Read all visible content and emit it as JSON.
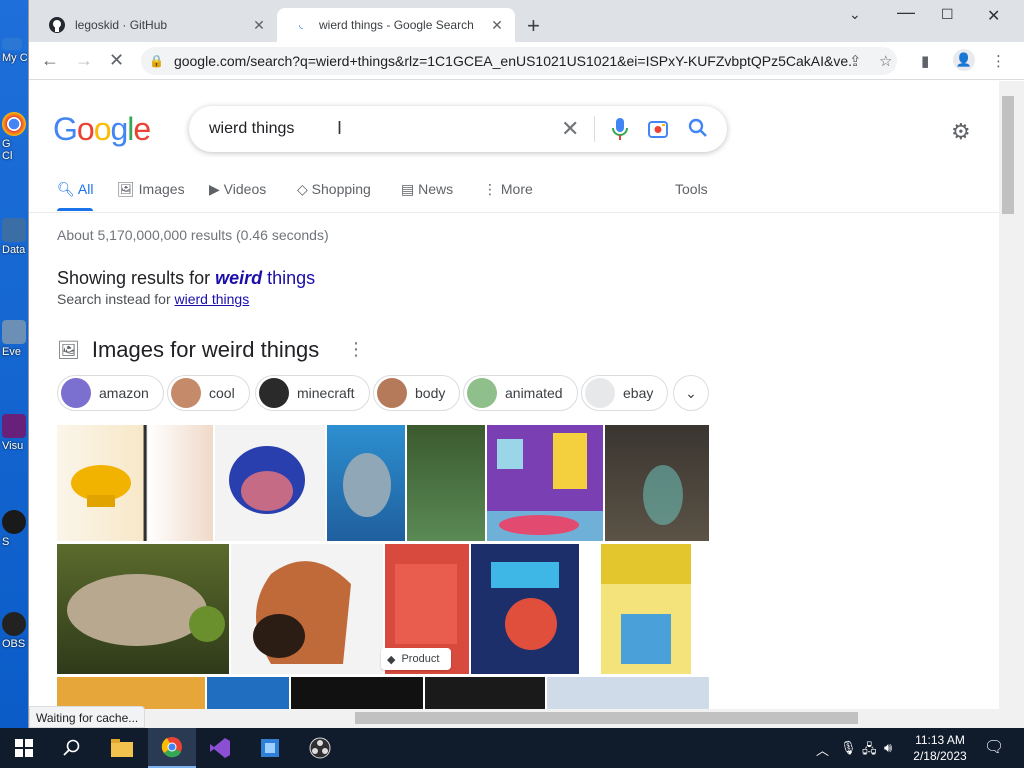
{
  "browser": {
    "tabs": [
      {
        "title": "legoskid · GitHub",
        "active": false
      },
      {
        "title": "wierd things - Google Search",
        "active": true
      }
    ],
    "url": "google.com/search?q=wierd+things&rlz=1C1GCEA_enUS1021US1021&ei=ISPxY-KUFZvbptQPz5CakAI&ve...",
    "status": "Waiting for cache..."
  },
  "google": {
    "logo": "Google",
    "query": "wierd things",
    "tabs": [
      "All",
      "Images",
      "Videos",
      "Shopping",
      "News",
      "More"
    ],
    "tools": "Tools",
    "stats": "About 5,170,000,000 results (0.46 seconds)",
    "showing_prefix": "Showing results for ",
    "showing_bold": "weird",
    "showing_rest": " things",
    "instead_prefix": "Search instead for ",
    "instead_link": "wierd things",
    "images_heading": "Images for weird things",
    "chips": [
      "amazon",
      "cool",
      "minecraft",
      "body",
      "animated",
      "ebay"
    ],
    "product_badge": "Product"
  },
  "desktop_labels": [
    "My C",
    "G",
    "Cl",
    "Data",
    "Eve",
    "Visu",
    "S",
    "OBS"
  ],
  "taskbar": {
    "time": "11:13 AM",
    "date": "2/18/2023"
  },
  "colors": {
    "accent": "#1a73e8",
    "link": "#1a0dab",
    "taskbar": "#101b2c"
  }
}
